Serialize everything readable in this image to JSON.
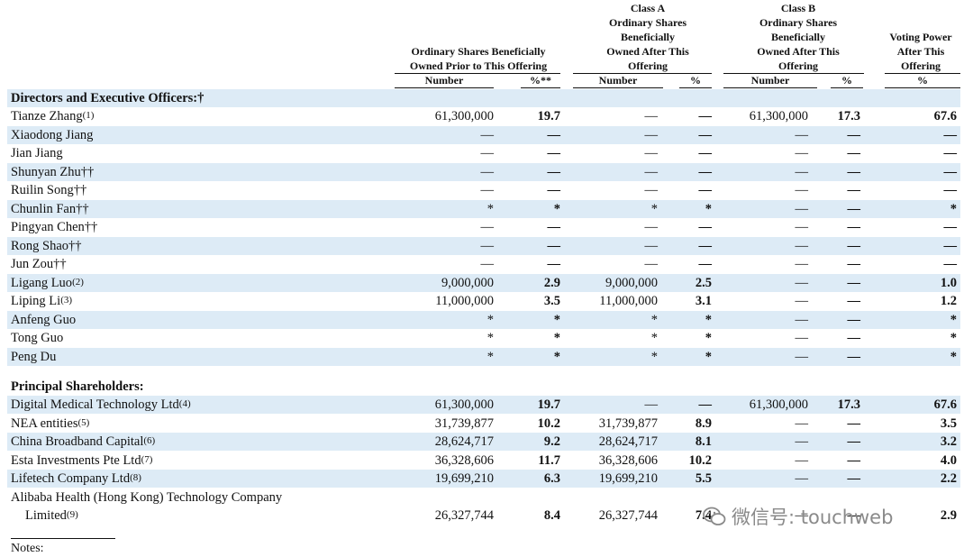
{
  "headers": {
    "prior": "Ordinary Shares Beneficially Owned Prior to This Offering",
    "prior_l1": "Ordinary Shares Beneficially",
    "prior_l2": "Owned Prior to This Offering",
    "classA_l1": "Class A",
    "classA_l2": "Ordinary Shares",
    "classA_l3": "Beneficially",
    "classA_l4": "Owned After This",
    "classA_l5": "Offering",
    "classB_l1": "Class B",
    "classB_l2": "Ordinary Shares",
    "classB_l3": "Beneficially",
    "classB_l4": "Owned After This",
    "classB_l5": "Offering",
    "voting_l1": "Voting Power",
    "voting_l2": "After This",
    "voting_l3": "Offering",
    "sub_number": "Number",
    "sub_pct_prior": "%**",
    "sub_pct": "%"
  },
  "sections": {
    "directors": "Directors and Executive Officers:†",
    "principal": "Principal Shareholders:"
  },
  "rows": [
    {
      "name": "Tianze Zhang",
      "note": "(1)",
      "pn": "61,300,000",
      "pp": "19.7",
      "an": "—",
      "ap": "—",
      "bn": "61,300,000",
      "bp": "17.3",
      "v": "67.6"
    },
    {
      "name": "Xiaodong Jiang",
      "note": "",
      "pn": "—",
      "pp": "—",
      "an": "—",
      "ap": "—",
      "bn": "—",
      "bp": "—",
      "v": "—"
    },
    {
      "name": "Jian Jiang",
      "note": "",
      "pn": "—",
      "pp": "—",
      "an": "—",
      "ap": "—",
      "bn": "—",
      "bp": "—",
      "v": "—"
    },
    {
      "name": "Shunyan Zhu††",
      "note": "",
      "pn": "—",
      "pp": "—",
      "an": "—",
      "ap": "—",
      "bn": "—",
      "bp": "—",
      "v": "—"
    },
    {
      "name": "Ruilin Song††",
      "note": "",
      "pn": "—",
      "pp": "—",
      "an": "—",
      "ap": "—",
      "bn": "—",
      "bp": "—",
      "v": "—"
    },
    {
      "name": "Chunlin Fan††",
      "note": "",
      "pn": "*",
      "pp": "*",
      "an": "*",
      "ap": "*",
      "bn": "—",
      "bp": "—",
      "v": "*"
    },
    {
      "name": "Pingyan Chen††",
      "note": "",
      "pn": "—",
      "pp": "—",
      "an": "—",
      "ap": "—",
      "bn": "—",
      "bp": "—",
      "v": "—"
    },
    {
      "name": "Rong Shao††",
      "note": "",
      "pn": "—",
      "pp": "—",
      "an": "—",
      "ap": "—",
      "bn": "—",
      "bp": "—",
      "v": "—"
    },
    {
      "name": "Jun Zou††",
      "note": "",
      "pn": "—",
      "pp": "—",
      "an": "—",
      "ap": "—",
      "bn": "—",
      "bp": "—",
      "v": "—"
    },
    {
      "name": "Ligang Luo",
      "note": "(2)",
      "pn": "9,000,000",
      "pp": "2.9",
      "an": "9,000,000",
      "ap": "2.5",
      "bn": "—",
      "bp": "—",
      "v": "1.0"
    },
    {
      "name": "Liping Li",
      "note": "(3)",
      "pn": "11,000,000",
      "pp": "3.5",
      "an": "11,000,000",
      "ap": "3.1",
      "bn": "—",
      "bp": "—",
      "v": "1.2"
    },
    {
      "name": "Anfeng Guo",
      "note": "",
      "pn": "*",
      "pp": "*",
      "an": "*",
      "ap": "*",
      "bn": "—",
      "bp": "—",
      "v": "*"
    },
    {
      "name": "Tong Guo",
      "note": "",
      "pn": "*",
      "pp": "*",
      "an": "*",
      "ap": "*",
      "bn": "—",
      "bp": "—",
      "v": "*"
    },
    {
      "name": "Peng Du",
      "note": "",
      "pn": "*",
      "pp": "*",
      "an": "*",
      "ap": "*",
      "bn": "—",
      "bp": "—",
      "v": "*"
    }
  ],
  "principal_rows": [
    {
      "name": "Digital Medical Technology Ltd",
      "note": "(4)",
      "pn": "61,300,000",
      "pp": "19.7",
      "an": "—",
      "ap": "—",
      "bn": "61,300,000",
      "bp": "17.3",
      "v": "67.6"
    },
    {
      "name": "NEA entities",
      "note": "(5)",
      "pn": "31,739,877",
      "pp": "10.2",
      "an": "31,739,877",
      "ap": "8.9",
      "bn": "—",
      "bp": "—",
      "v": "3.5"
    },
    {
      "name": "China Broadband Capital",
      "note": "(6)",
      "pn": "28,624,717",
      "pp": "9.2",
      "an": "28,624,717",
      "ap": "8.1",
      "bn": "—",
      "bp": "—",
      "v": "3.2"
    },
    {
      "name": "Esta Investments Pte Ltd",
      "note": "(7)",
      "pn": "36,328,606",
      "pp": "11.7",
      "an": "36,328,606",
      "ap": "10.2",
      "bn": "—",
      "bp": "—",
      "v": "4.0"
    },
    {
      "name": "Lifetech Company Ltd",
      "note": "(8)",
      "pn": "19,699,210",
      "pp": "6.3",
      "an": "19,699,210",
      "ap": "5.5",
      "bn": "—",
      "bp": "—",
      "v": "2.2"
    },
    {
      "name": "Alibaba Health (Hong Kong) Technology Company",
      "name2": "Limited",
      "note": "(9)",
      "pn": "26,327,744",
      "pp": "8.4",
      "an": "26,327,744",
      "ap": "7.4",
      "bn": "—",
      "bp": "—",
      "v": "2.9"
    }
  ],
  "notes_label": "Notes:",
  "watermark": "微信号: touchweb"
}
